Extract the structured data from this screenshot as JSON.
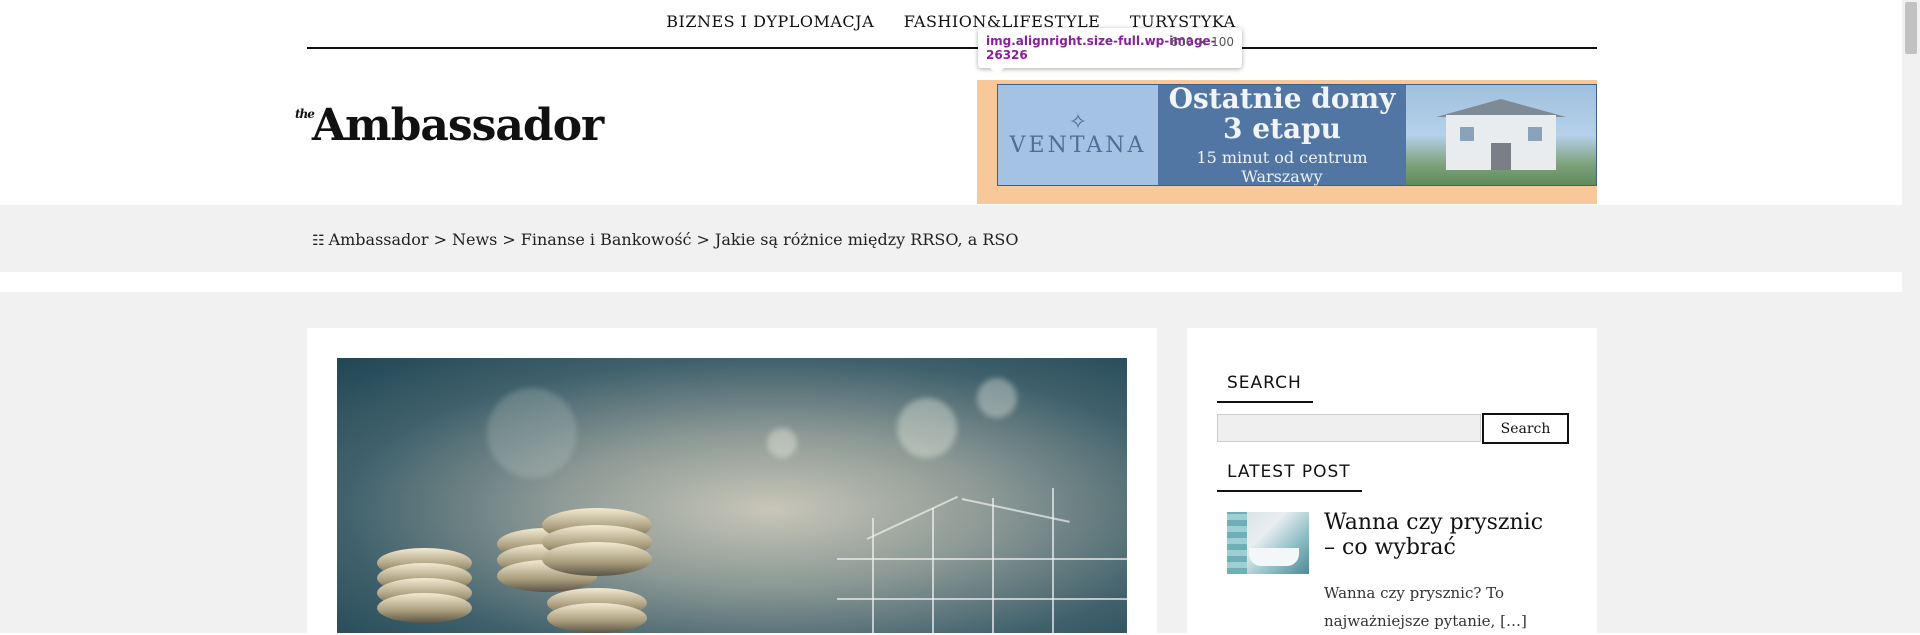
{
  "nav": {
    "items": [
      "Biznes i dyplomacja",
      "Fashion&Lifestyle",
      "Turystyka"
    ]
  },
  "logo": {
    "prefix": "the",
    "name": "Ambassador"
  },
  "banner": {
    "brand": "VENTANA",
    "headline_1": "Ostatnie domy",
    "headline_2": "3 etapu",
    "subline": "15 minut od centrum Warszawy",
    "bg_color": "#f9c89a",
    "accent_color": "#5276a3"
  },
  "devtools_tooltip": {
    "selector": "img.alignright.size-full.wp-image-26326",
    "dimensions": "600 × 100"
  },
  "breadcrumb": {
    "icon": "sitemap-icon",
    "items": [
      "Ambassador",
      "News",
      "Finanse i Bankowość",
      "Jakie są różnice między RRSO, a RSO"
    ],
    "separator": ">"
  },
  "sidebar": {
    "search_title": "SEARCH",
    "search_placeholder": "",
    "search_button": "Search",
    "latest_title": "LATEST POST",
    "latest_post": {
      "title": "Wanna czy prysznic – co wybrać",
      "excerpt": "Wanna czy prysznic? To najważniejsze pytanie, […]"
    }
  }
}
